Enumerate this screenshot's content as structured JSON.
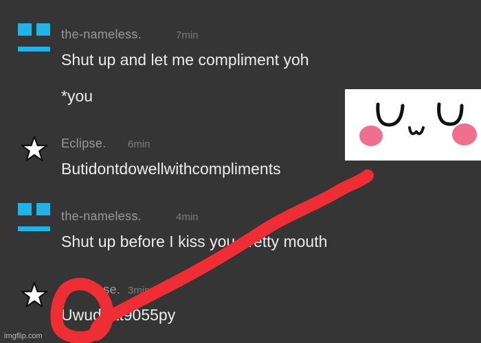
{
  "messages": [
    {
      "avatar": "nameless-face-icon",
      "username": "the-nameless.",
      "time": "7min",
      "lines": [
        "Shut up and let me compliment yoh",
        "*you"
      ]
    },
    {
      "avatar": "star-icon",
      "username": "Eclipse.",
      "time": "6min",
      "lines": [
        "Butidontdowellwithcompliments"
      ]
    },
    {
      "avatar": "nameless-face-icon",
      "username": "the-nameless.",
      "time": "4min",
      "lines": [
        "Shut up before I kiss you   pretty mouth"
      ]
    },
    {
      "avatar": "star-icon",
      "username": "ose.",
      "time": "3min",
      "lines": [
        "Uwud   5tt9055py"
      ]
    }
  ],
  "sticker": {
    "name": "uwu-face-sticker",
    "text": "UwU",
    "blush_color": "#ef6f8c",
    "line_color": "#111111"
  },
  "annotation": {
    "name": "red-scribble",
    "color": "#ee2d35"
  },
  "watermark": "imgflip.com",
  "colors": {
    "background": "#353535",
    "accent": "#1fb3e8",
    "username": "#9a9a9a",
    "text": "#ececec"
  }
}
